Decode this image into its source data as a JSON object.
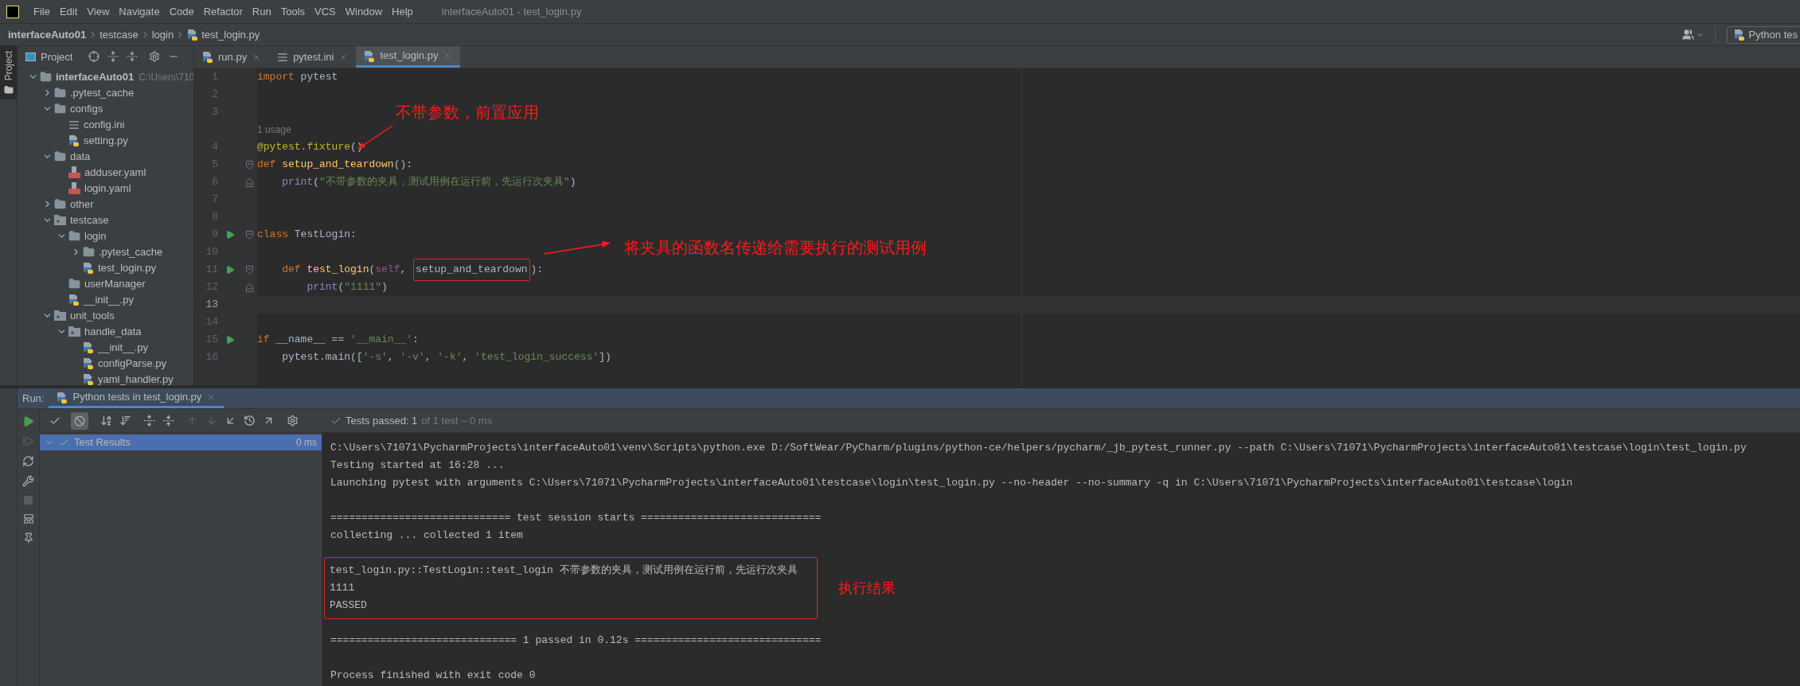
{
  "menu": [
    "File",
    "Edit",
    "View",
    "Navigate",
    "Code",
    "Refactor",
    "Run",
    "Tools",
    "VCS",
    "Window",
    "Help"
  ],
  "window_title": "interfaceAuto01 - test_login.py",
  "breadcrumb": [
    "interfaceAuto01",
    "testcase",
    "login",
    "test_login.py"
  ],
  "run_config": "Python tes",
  "side_stripe": {
    "label": "Project",
    "selected": true
  },
  "project_panel": {
    "title": "Project"
  },
  "tree": {
    "label": "interfaceAuto01",
    "path": "C:\\Users\\710",
    "kind": "folder",
    "expanded": true,
    "children": [
      {
        "label": ".pytest_cache",
        "kind": "folder",
        "expanded": false
      },
      {
        "label": "configs",
        "kind": "folder",
        "expanded": true,
        "children": [
          {
            "label": "config.ini",
            "kind": "ini"
          },
          {
            "label": "setting.py",
            "kind": "python"
          }
        ]
      },
      {
        "label": "data",
        "kind": "folder",
        "expanded": true,
        "children": [
          {
            "label": "adduser.yaml",
            "kind": "yaml"
          },
          {
            "label": "login.yaml",
            "kind": "yaml"
          }
        ]
      },
      {
        "label": "other",
        "kind": "folder",
        "expanded": false
      },
      {
        "label": "testcase",
        "kind": "package",
        "expanded": true,
        "children": [
          {
            "label": "login",
            "kind": "folder",
            "expanded": true,
            "children": [
              {
                "label": ".pytest_cache",
                "kind": "folder",
                "expanded": false
              },
              {
                "label": "test_login.py",
                "kind": "python"
              }
            ]
          },
          {
            "label": "userManager",
            "kind": "folder"
          },
          {
            "label": "__init__.py",
            "kind": "python"
          }
        ]
      },
      {
        "label": "unit_tools",
        "kind": "package",
        "expanded": true,
        "children": [
          {
            "label": "handle_data",
            "kind": "package",
            "expanded": true,
            "children": [
              {
                "label": "__init__.py",
                "kind": "python"
              },
              {
                "label": "configParse.py",
                "kind": "python"
              },
              {
                "label": "yaml_handler.py",
                "kind": "python"
              }
            ]
          }
        ]
      }
    ]
  },
  "editor_tabs": [
    {
      "label": "run.py",
      "kind": "python",
      "selected": false
    },
    {
      "label": "pytest.ini",
      "kind": "ini",
      "selected": false
    },
    {
      "label": "test_login.py",
      "kind": "python",
      "selected": true
    }
  ],
  "editor": {
    "lines": [
      {
        "kind": "code",
        "number": "1",
        "tokens": [
          {
            "kind": "keyword",
            "text": "import"
          },
          {
            "kind": "plain",
            "text": " pytest"
          }
        ]
      },
      {
        "kind": "code",
        "number": "2"
      },
      {
        "kind": "code",
        "number": "3"
      },
      {
        "kind": "hint",
        "text": "1 usage"
      },
      {
        "kind": "code",
        "number": "4",
        "tokens": [
          {
            "kind": "decorator",
            "text": "@pytest.fixture"
          },
          {
            "kind": "plain",
            "text": "()"
          }
        ]
      },
      {
        "kind": "code",
        "number": "5",
        "fold_open": true,
        "tokens": [
          {
            "kind": "keyword",
            "text": "def "
          },
          {
            "kind": "function",
            "text": "setup_and_teardown"
          },
          {
            "kind": "plain",
            "text": "():"
          }
        ]
      },
      {
        "kind": "code",
        "number": "6",
        "fold_close": true,
        "tokens": [
          {
            "kind": "builtin",
            "text": "    print"
          },
          {
            "kind": "plain",
            "text": "("
          },
          {
            "kind": "string",
            "text": "\"不带参数的夹具，测试用例在运行前，先运行次夹具\""
          },
          {
            "kind": "plain",
            "text": ")"
          }
        ]
      },
      {
        "kind": "code",
        "number": "7"
      },
      {
        "kind": "code",
        "number": "8"
      },
      {
        "kind": "code",
        "number": "9",
        "run": true,
        "fold_open": true,
        "tokens": [
          {
            "kind": "keyword",
            "text": "class"
          },
          {
            "kind": "plain",
            "text": " TestLogin:"
          }
        ]
      },
      {
        "kind": "code",
        "number": "10"
      },
      {
        "kind": "code",
        "number": "11",
        "run": true,
        "fold_open": true,
        "tokens": [
          {
            "kind": "keyword",
            "text": "    def "
          },
          {
            "kind": "function",
            "text": "test_login"
          },
          {
            "kind": "plain",
            "text": "("
          },
          {
            "kind": "self",
            "text": "self"
          },
          {
            "kind": "plain",
            "text": ", "
          },
          {
            "kind": "plain",
            "text": "setup_and_teardown",
            "boxed": true
          },
          {
            "kind": "plain",
            "text": "):"
          }
        ]
      },
      {
        "kind": "code",
        "number": "12",
        "fold_close": true,
        "tokens": [
          {
            "kind": "builtin",
            "text": "        print"
          },
          {
            "kind": "plain",
            "text": "("
          },
          {
            "kind": "string",
            "text": "\"1111\""
          },
          {
            "kind": "plain",
            "text": ")"
          }
        ]
      },
      {
        "kind": "code",
        "number": "13",
        "current": true
      },
      {
        "kind": "code",
        "number": "14"
      },
      {
        "kind": "code",
        "number": "15",
        "run": true,
        "tokens": [
          {
            "kind": "keyword",
            "text": "if"
          },
          {
            "kind": "plain",
            "text": " __name__ == "
          },
          {
            "kind": "string",
            "text": "'__main__'"
          },
          {
            "kind": "plain",
            "text": ":"
          }
        ]
      },
      {
        "kind": "code",
        "number": "16",
        "tokens": [
          {
            "kind": "plain",
            "text": "    pytest.main(["
          },
          {
            "kind": "string",
            "text": "'-s'"
          },
          {
            "kind": "plain",
            "text": ", "
          },
          {
            "kind": "string",
            "text": "'-v'"
          },
          {
            "kind": "plain",
            "text": ", "
          },
          {
            "kind": "string",
            "text": "'-k'"
          },
          {
            "kind": "plain",
            "text": ", "
          },
          {
            "kind": "string",
            "text": "'test_login_success'"
          },
          {
            "kind": "plain",
            "text": "])"
          }
        ]
      }
    ]
  },
  "annotations": [
    {
      "kind": "arrow_note",
      "text": "不带参数，前置应用"
    },
    {
      "kind": "arrow_note",
      "text": "将夹具的函数名传递给需要执行的测试用例"
    }
  ],
  "run": {
    "label": "Run:",
    "tab": "Python tests in test_login.py",
    "toggles": [
      {
        "on": false
      },
      {
        "on": true
      }
    ],
    "status": {
      "passed": "Tests passed: 1",
      "detail": "of 1 test – 0 ms"
    },
    "results": [
      {
        "label": "Test Results",
        "time": "0 ms",
        "selected": true,
        "expanded": true
      }
    ]
  },
  "console": [
    {
      "kind": "plain",
      "lines": [
        "C:\\Users\\71071\\PycharmProjects\\interfaceAuto01\\venv\\Scripts\\python.exe D:/SoftWear/PyCharm/plugins/python-ce/helpers/pycharm/_jb_pytest_runner.py --path C:\\Users\\71071\\PycharmProjects\\interfaceAuto01\\testcase\\login\\test_login.py",
        "Testing started at 16:28 ...",
        "Launching pytest with arguments C:\\Users\\71071\\PycharmProjects\\interfaceAuto01\\testcase\\login\\test_login.py --no-header --no-summary -q in C:\\Users\\71071\\PycharmProjects\\interfaceAuto01\\testcase\\login"
      ]
    },
    {
      "kind": "plain",
      "lines": [
        "============================= test session starts =============================",
        "collecting ... collected 1 item"
      ]
    },
    {
      "kind": "boxed",
      "callout": "执行结果",
      "lines": [
        "test_login.py::TestLogin::test_login 不带参数的夹具，测试用例在运行前，先运行次夹具",
        "1111",
        "PASSED"
      ]
    },
    {
      "kind": "plain",
      "lines": [
        "============================== 1 passed in 0.12s =============================="
      ]
    },
    {
      "kind": "plain",
      "lines": [
        "Process finished with exit code 0"
      ]
    }
  ]
}
